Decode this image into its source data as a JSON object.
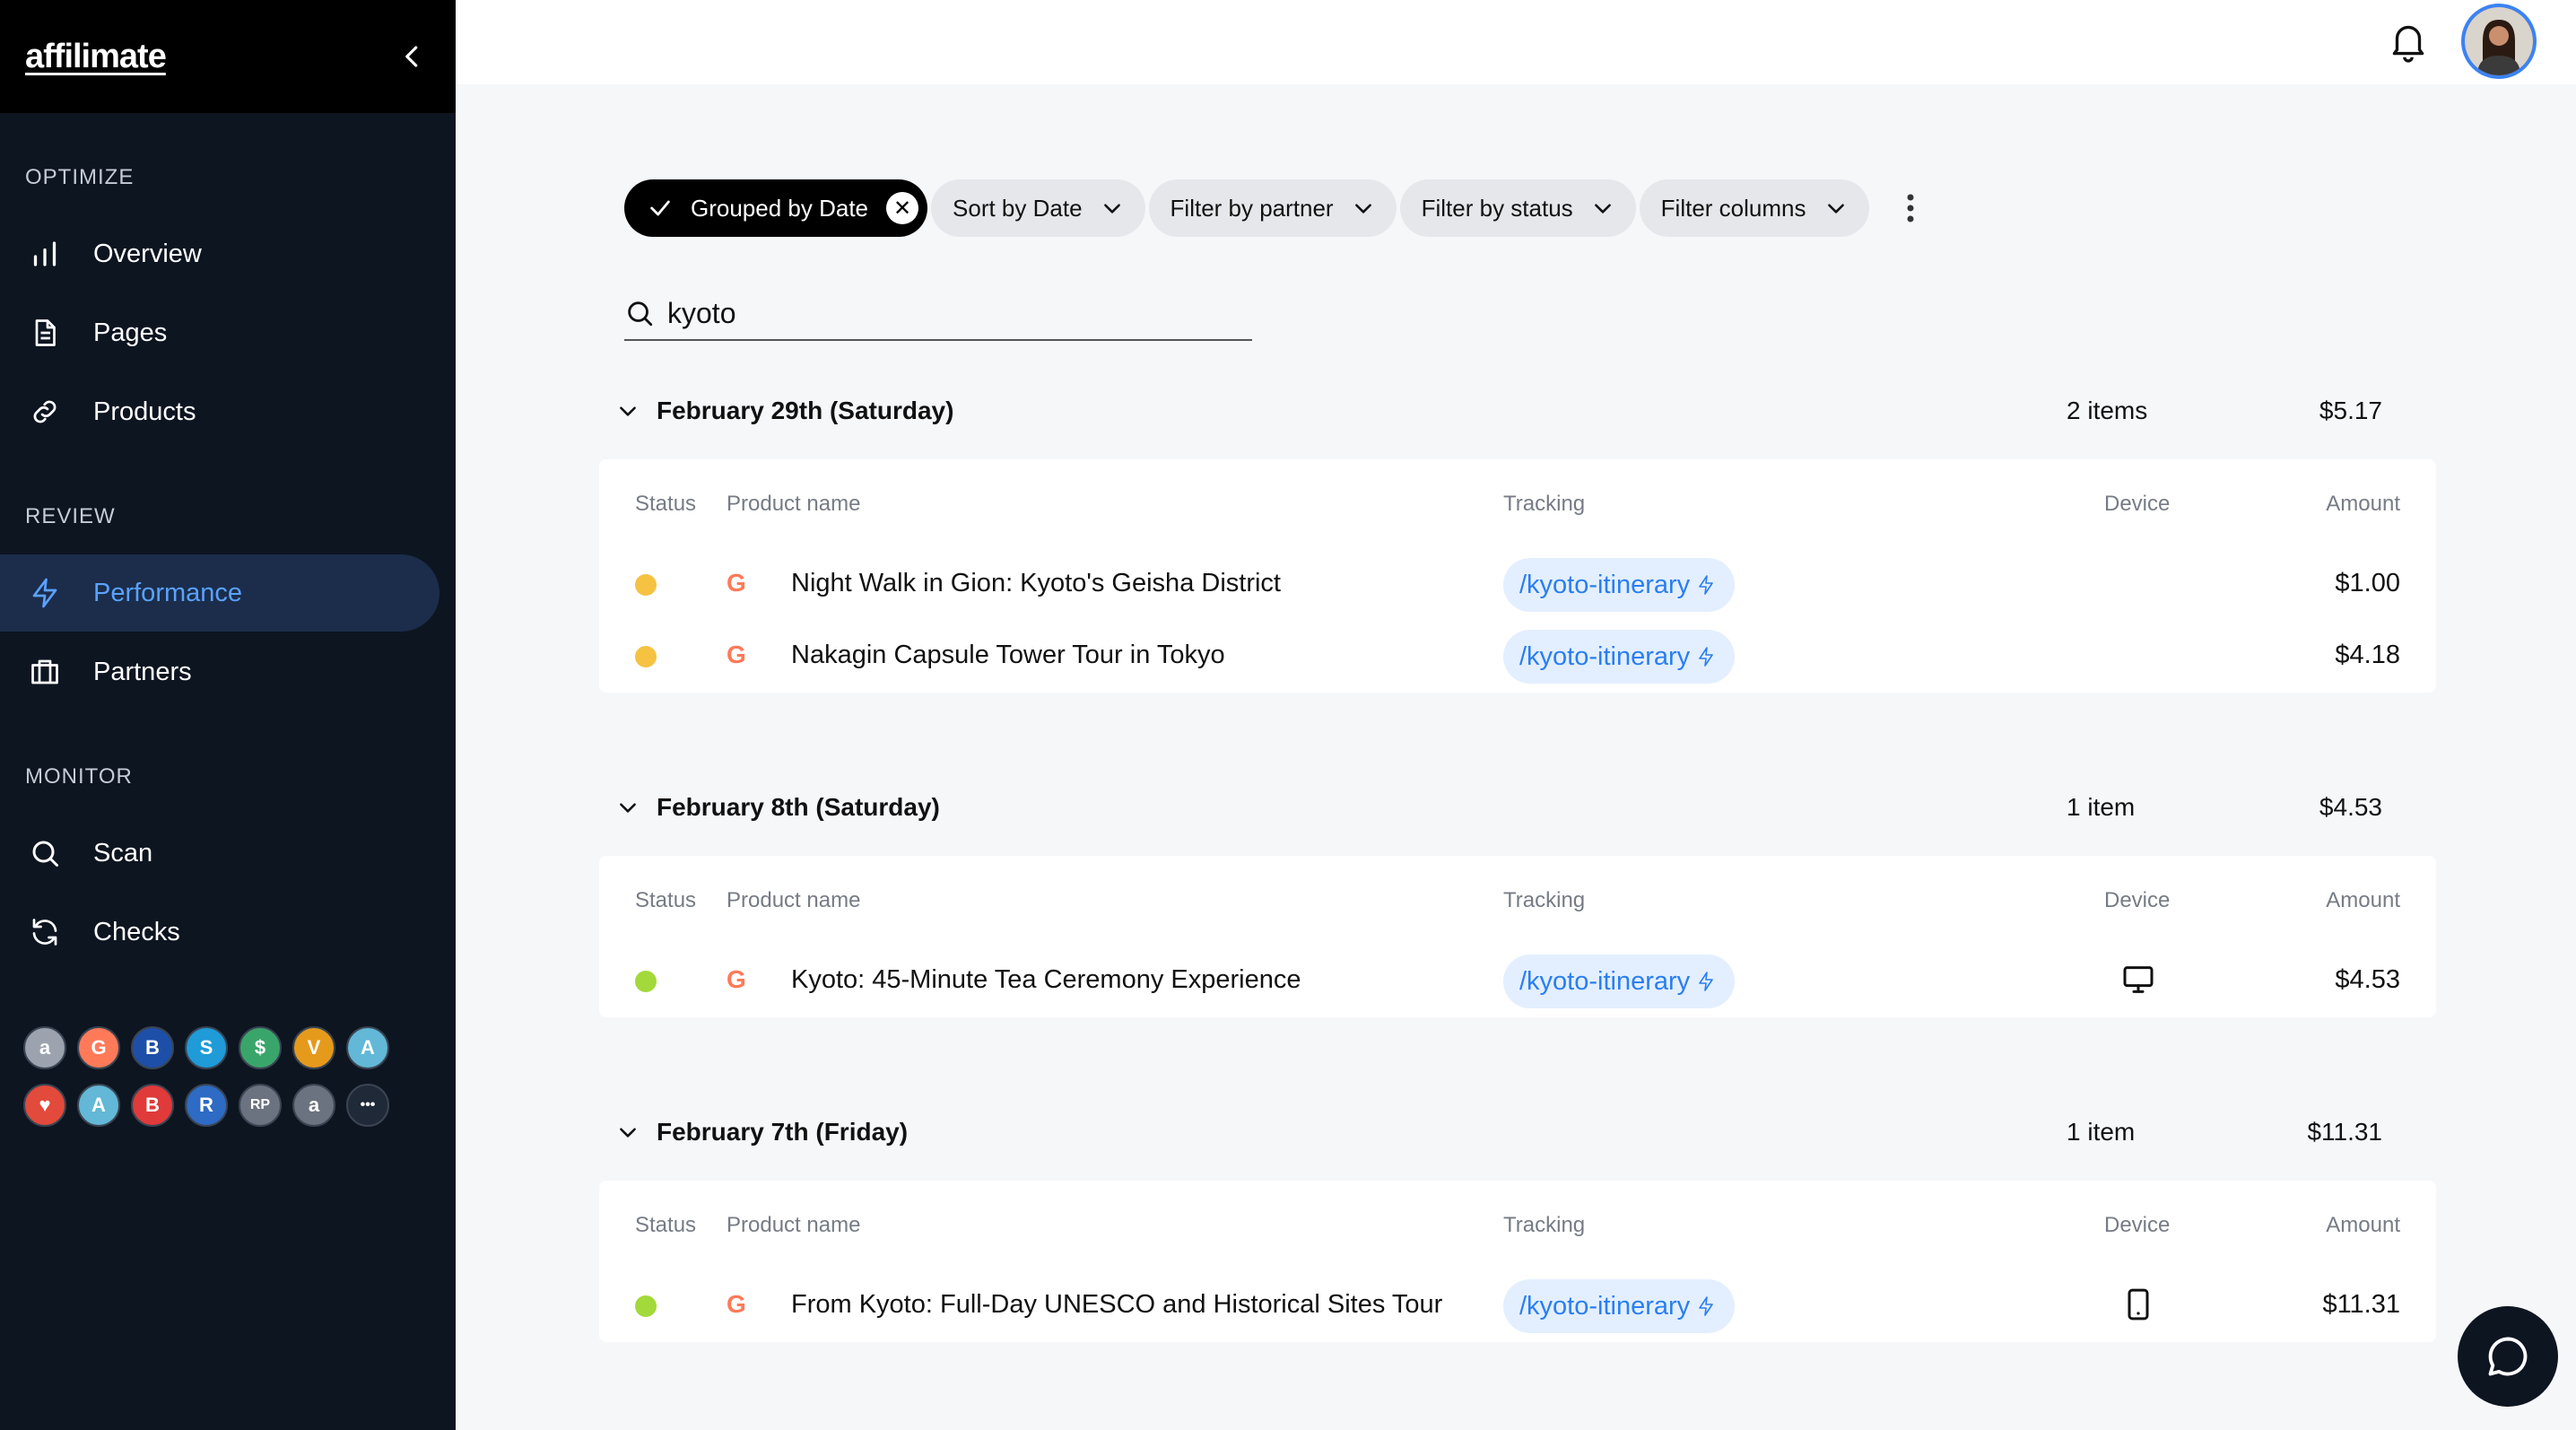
{
  "app": {
    "logo": "affilimate"
  },
  "sidebar": {
    "sections": [
      {
        "label": "OPTIMIZE"
      },
      {
        "label": "REVIEW"
      },
      {
        "label": "MONITOR"
      }
    ],
    "items": [
      {
        "label": "Overview",
        "icon": "bar-chart-icon"
      },
      {
        "label": "Pages",
        "icon": "document-icon"
      },
      {
        "label": "Products",
        "icon": "link-icon"
      },
      {
        "label": "Performance",
        "icon": "lightning-icon",
        "active": true
      },
      {
        "label": "Partners",
        "icon": "briefcase-icon"
      },
      {
        "label": "Scan",
        "icon": "search-icon"
      },
      {
        "label": "Checks",
        "icon": "refresh-icon"
      }
    ],
    "partners": [
      {
        "glyph": "a",
        "color": "#9ca3af",
        "name": "amazon"
      },
      {
        "glyph": "G",
        "color": "#ff7a59",
        "name": "getyourguide"
      },
      {
        "glyph": "B",
        "color": "#1e4fa8",
        "name": "booking"
      },
      {
        "glyph": "S",
        "color": "#1f9bd8",
        "name": "skimlinks"
      },
      {
        "glyph": "$",
        "color": "#3aa56a",
        "name": "shareasale"
      },
      {
        "glyph": "V",
        "color": "#e59a1c",
        "name": "viator"
      },
      {
        "glyph": "A",
        "color": "#62b8d6",
        "name": "awin"
      },
      {
        "glyph": "♥",
        "color": "#e24a3b",
        "name": "partner-8"
      },
      {
        "glyph": "A",
        "color": "#62b8d6",
        "name": "partner-9"
      },
      {
        "glyph": "B",
        "color": "#e03a3a",
        "name": "partner-10"
      },
      {
        "glyph": "R",
        "color": "#2d6bc4",
        "name": "partner-11"
      },
      {
        "glyph": "RP",
        "color": "#6b7280",
        "name": "partner-12"
      },
      {
        "glyph": "a",
        "color": "#6b7280",
        "name": "partner-13"
      },
      {
        "glyph": "•••",
        "color": "#1f2937",
        "name": "more"
      }
    ]
  },
  "filters": {
    "grouped": "Grouped by Date",
    "sort": "Sort by Date",
    "partner": "Filter by partner",
    "status": "Filter by status",
    "columns": "Filter columns"
  },
  "search": {
    "value": "kyoto"
  },
  "table_headers": {
    "status": "Status",
    "product": "Product name",
    "tracking": "Tracking",
    "device": "Device",
    "amount": "Amount"
  },
  "groups": [
    {
      "title": "February 29th (Saturday)",
      "count": "2 items",
      "total": "$5.17",
      "rows": [
        {
          "status": "#f5c242",
          "product": "Night Walk in Gion: Kyoto's Geisha District",
          "tracking": "/kyoto-itinerary",
          "device": "",
          "amount": "$1.00"
        },
        {
          "status": "#f5c242",
          "product": "Nakagin Capsule Tower Tour in Tokyo",
          "tracking": "/kyoto-itinerary",
          "device": "",
          "amount": "$4.18"
        }
      ]
    },
    {
      "title": "February 8th (Saturday)",
      "count": "1 item",
      "total": "$4.53",
      "rows": [
        {
          "status": "#a3d93a",
          "product": "Kyoto: 45-Minute Tea Ceremony Experience",
          "tracking": "/kyoto-itinerary",
          "device": "desktop-icon",
          "amount": "$4.53"
        }
      ]
    },
    {
      "title": "February 7th (Friday)",
      "count": "1 item",
      "total": "$11.31",
      "rows": [
        {
          "status": "#a3d93a",
          "product": "From Kyoto: Full-Day UNESCO and Historical Sites Tour",
          "tracking": "/kyoto-itinerary",
          "device": "mobile-icon",
          "amount": "$11.31"
        }
      ]
    }
  ]
}
